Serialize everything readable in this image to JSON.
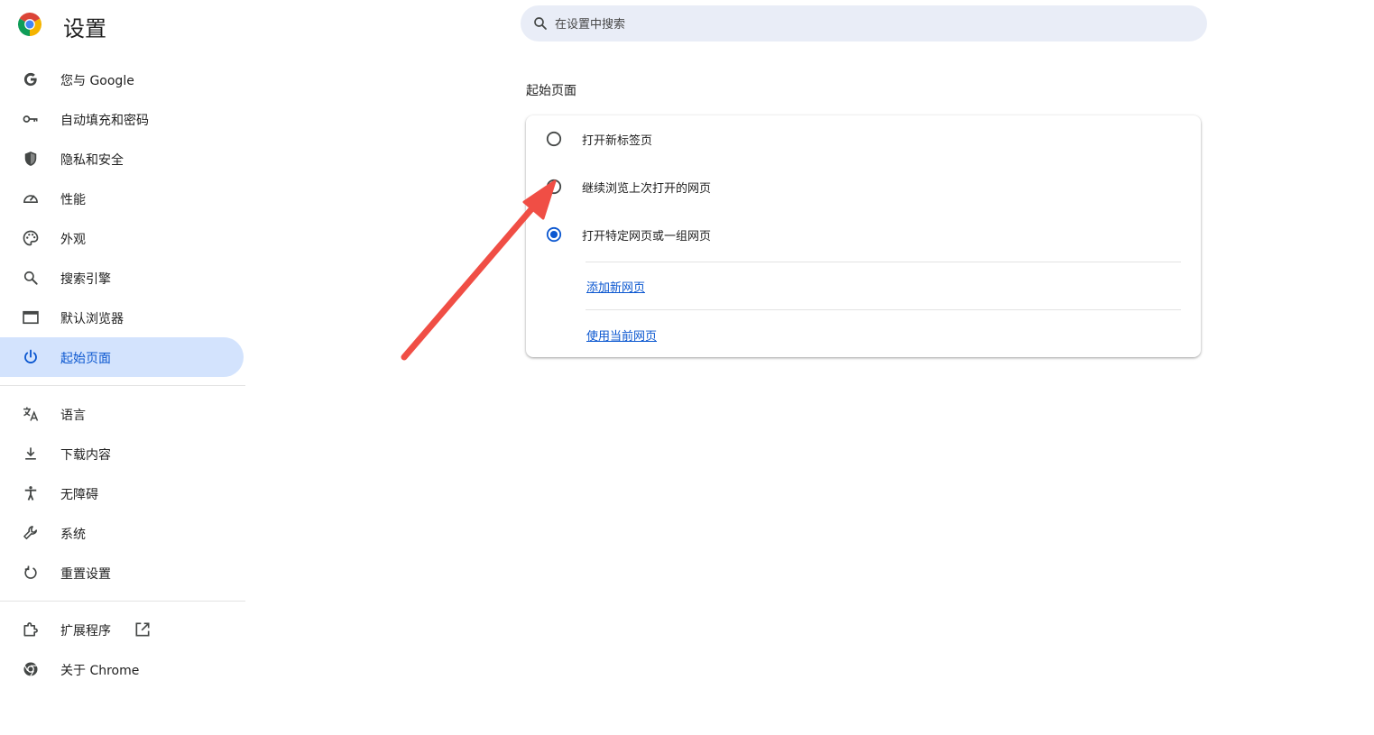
{
  "header": {
    "title": "设置"
  },
  "search": {
    "placeholder": "在设置中搜索"
  },
  "sidebar": {
    "items": [
      {
        "label": "您与 Google",
        "icon": "google-icon"
      },
      {
        "label": "自动填充和密码",
        "icon": "key-icon"
      },
      {
        "label": "隐私和安全",
        "icon": "shield-icon"
      },
      {
        "label": "性能",
        "icon": "speedometer-icon"
      },
      {
        "label": "外观",
        "icon": "palette-icon"
      },
      {
        "label": "搜索引擎",
        "icon": "search-icon"
      },
      {
        "label": "默认浏览器",
        "icon": "browser-window-icon"
      },
      {
        "label": "起始页面",
        "icon": "power-icon",
        "active": true
      }
    ],
    "items2": [
      {
        "label": "语言",
        "icon": "translate-icon"
      },
      {
        "label": "下载内容",
        "icon": "download-icon"
      },
      {
        "label": "无障碍",
        "icon": "accessibility-icon"
      },
      {
        "label": "系统",
        "icon": "wrench-icon"
      },
      {
        "label": "重置设置",
        "icon": "reset-icon"
      }
    ],
    "items3": [
      {
        "label": "扩展程序",
        "icon": "puzzle-icon"
      },
      {
        "label": "关于 Chrome",
        "icon": "chrome-icon"
      }
    ]
  },
  "main": {
    "section_title": "起始页面",
    "options": [
      {
        "label": "打开新标签页",
        "selected": false
      },
      {
        "label": "继续浏览上次打开的网页",
        "selected": false
      },
      {
        "label": "打开特定网页或一组网页",
        "selected": true
      }
    ],
    "links": [
      "添加新网页",
      "使用当前网页"
    ]
  },
  "colors": {
    "accent": "#0b57d0",
    "active_bg": "#d3e3fd",
    "search_bg": "#e9edf7",
    "arrow": "#f04e45"
  }
}
